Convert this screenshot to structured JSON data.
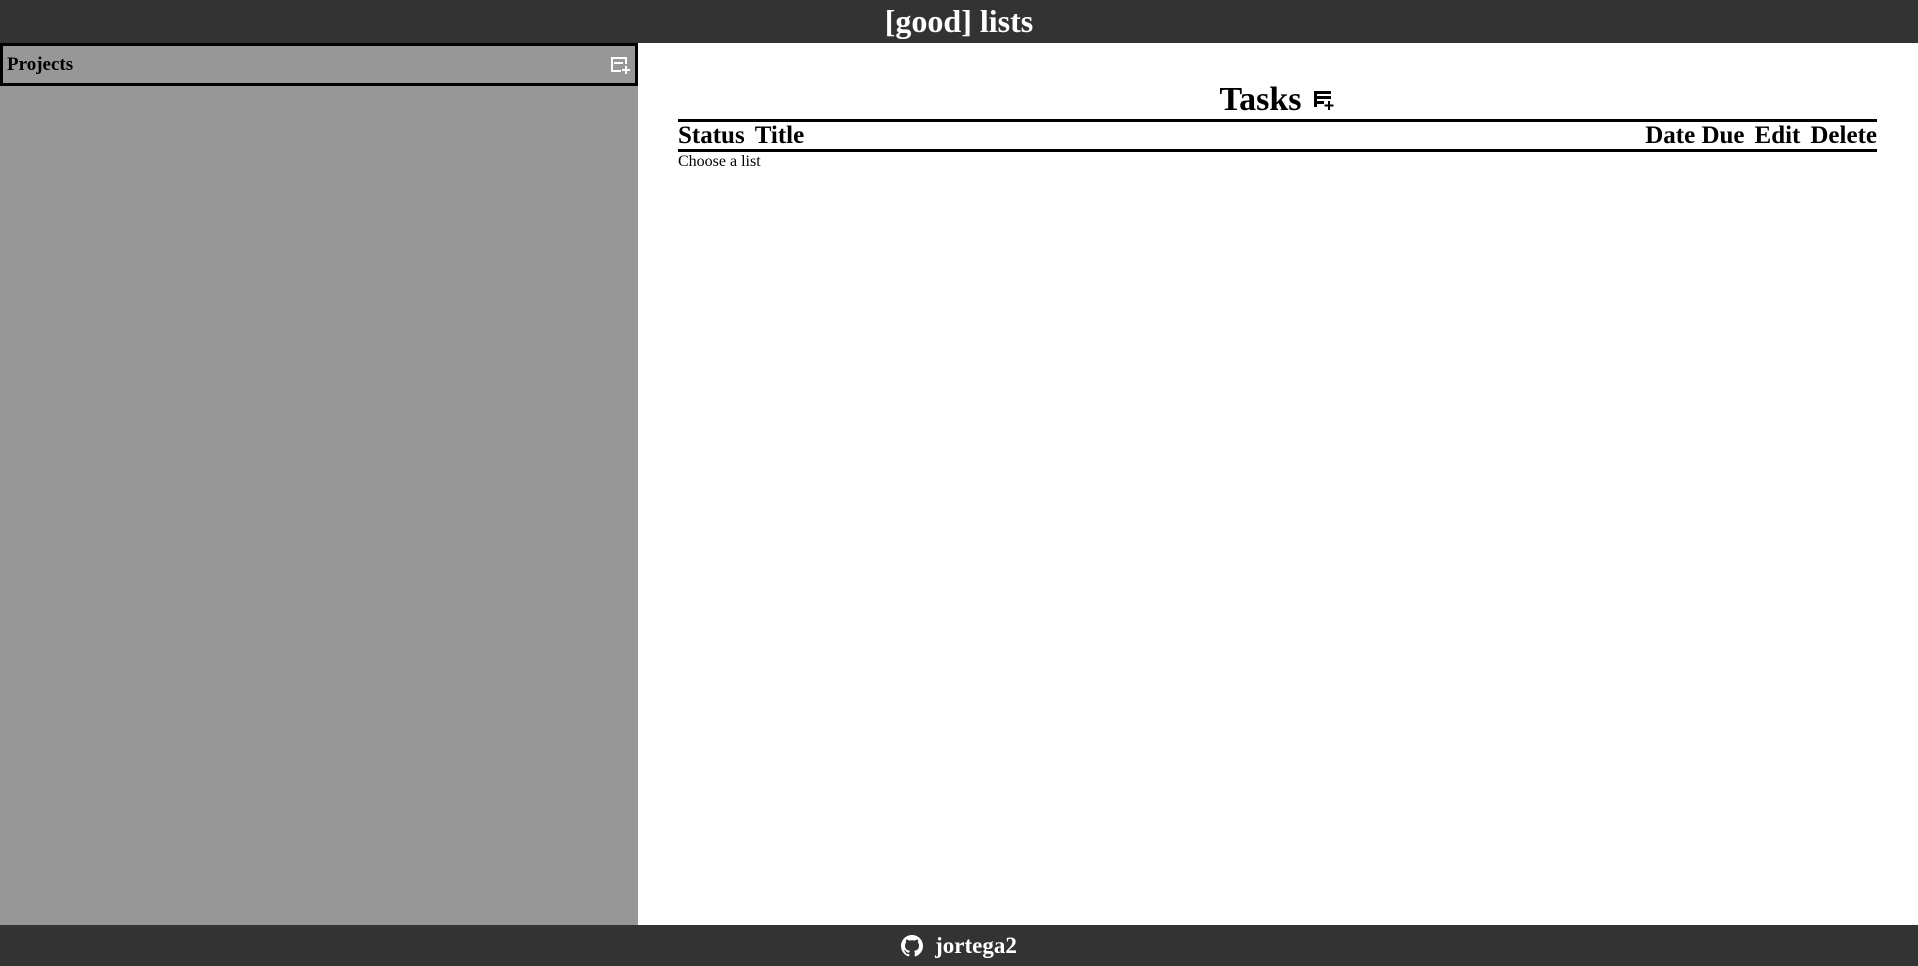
{
  "header": {
    "title": "[good] lists"
  },
  "sidebar": {
    "projects_label": "Projects",
    "add_project_icon": "add-list-icon"
  },
  "main": {
    "tasks_title": "Tasks",
    "add_task_icon": "add-list-icon",
    "columns": [
      "Status",
      "Title",
      "Date Due",
      "Edit",
      "Delete"
    ],
    "empty_message": "Choose a list"
  },
  "footer": {
    "github_icon": "github-icon",
    "username": "jortega2"
  },
  "colors": {
    "header_bg": "#333333",
    "sidebar_bg": "#979797",
    "main_bg": "#ffffff",
    "text_light": "#ffffff",
    "text_dark": "#000000"
  }
}
